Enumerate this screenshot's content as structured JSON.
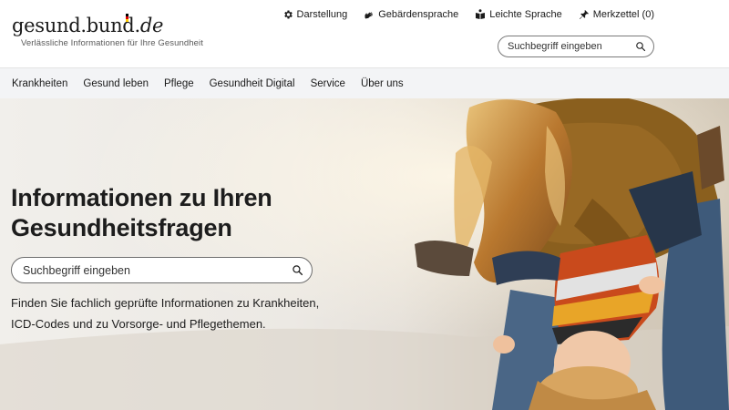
{
  "logo": {
    "name": "gesund.bund",
    "dot": ".",
    "tld": "de",
    "tagline": "Verlässliche Informationen für Ihre Gesundheit",
    "flag_colors": [
      "#000000",
      "#dd0000",
      "#ffcc00"
    ]
  },
  "meta_nav": [
    {
      "label": "Darstellung",
      "icon": "gear-icon"
    },
    {
      "label": "Gebärdensprache",
      "icon": "sign-language-icon"
    },
    {
      "label": "Leichte Sprache",
      "icon": "easy-language-icon"
    },
    {
      "label": "Merkzettel (0)",
      "icon": "pin-icon"
    }
  ],
  "search_top": {
    "placeholder": "Suchbegriff eingeben",
    "icon": "search-icon"
  },
  "nav": [
    {
      "label": "Krankheiten"
    },
    {
      "label": "Gesund leben"
    },
    {
      "label": "Pflege"
    },
    {
      "label": "Gesundheit Digital"
    },
    {
      "label": "Service"
    },
    {
      "label": "Über uns"
    }
  ],
  "hero": {
    "title": "Informationen zu Ihren Gesundheitsfragen",
    "search_placeholder": "Suchbegriff eingeben",
    "text": "Finden Sie fachlich geprüfte Informationen zu Krankheiten, ICD-Codes und zu Vorsorge- und Pflegethemen."
  },
  "colors": {
    "nav_bg": "#f3f4f6",
    "text": "#1d1d1d",
    "border": "#7a7a7a"
  }
}
